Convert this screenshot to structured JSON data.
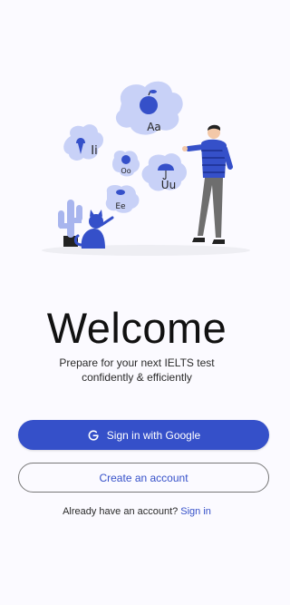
{
  "illustration": {
    "bubble_letters": [
      "Aa",
      "Ii",
      "Oo",
      "Uu",
      "Ee"
    ],
    "colors": {
      "bubble": "#c8d1f7",
      "accent": "#3550c9"
    }
  },
  "welcome": {
    "title": "Welcome",
    "subtitle_line1": "Prepare for your next IELTS test",
    "subtitle_line2": "confidently & efficiently"
  },
  "actions": {
    "google_label": "Sign in with Google",
    "google_icon": "google-g-icon",
    "create_label": "Create an account",
    "have_account_text": "Already have an account?",
    "sign_in_label": "Sign in"
  },
  "theme": {
    "primary": "#3550c9",
    "background": "#fbfaff"
  }
}
